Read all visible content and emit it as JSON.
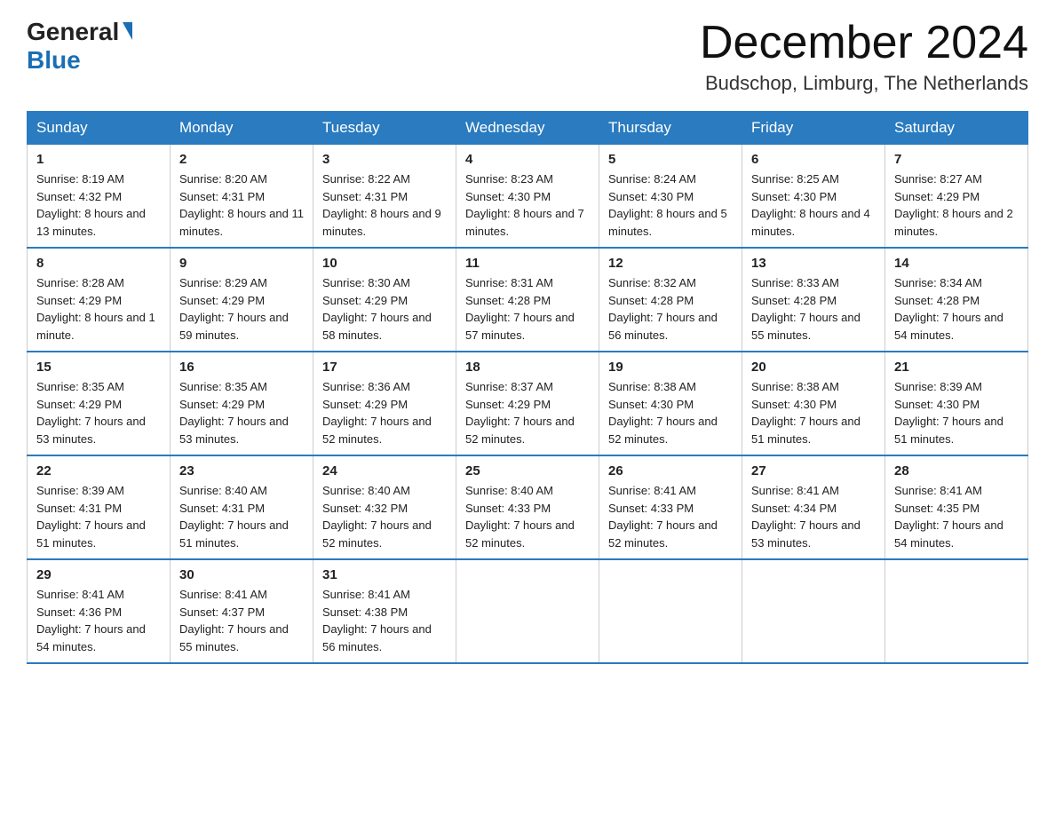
{
  "header": {
    "logo_general": "General",
    "logo_blue": "Blue",
    "month": "December 2024",
    "location": "Budschop, Limburg, The Netherlands"
  },
  "days_of_week": [
    "Sunday",
    "Monday",
    "Tuesday",
    "Wednesday",
    "Thursday",
    "Friday",
    "Saturday"
  ],
  "weeks": [
    [
      {
        "day": "1",
        "sunrise": "8:19 AM",
        "sunset": "4:32 PM",
        "daylight": "8 hours and 13 minutes."
      },
      {
        "day": "2",
        "sunrise": "8:20 AM",
        "sunset": "4:31 PM",
        "daylight": "8 hours and 11 minutes."
      },
      {
        "day": "3",
        "sunrise": "8:22 AM",
        "sunset": "4:31 PM",
        "daylight": "8 hours and 9 minutes."
      },
      {
        "day": "4",
        "sunrise": "8:23 AM",
        "sunset": "4:30 PM",
        "daylight": "8 hours and 7 minutes."
      },
      {
        "day": "5",
        "sunrise": "8:24 AM",
        "sunset": "4:30 PM",
        "daylight": "8 hours and 5 minutes."
      },
      {
        "day": "6",
        "sunrise": "8:25 AM",
        "sunset": "4:30 PM",
        "daylight": "8 hours and 4 minutes."
      },
      {
        "day": "7",
        "sunrise": "8:27 AM",
        "sunset": "4:29 PM",
        "daylight": "8 hours and 2 minutes."
      }
    ],
    [
      {
        "day": "8",
        "sunrise": "8:28 AM",
        "sunset": "4:29 PM",
        "daylight": "8 hours and 1 minute."
      },
      {
        "day": "9",
        "sunrise": "8:29 AM",
        "sunset": "4:29 PM",
        "daylight": "7 hours and 59 minutes."
      },
      {
        "day": "10",
        "sunrise": "8:30 AM",
        "sunset": "4:29 PM",
        "daylight": "7 hours and 58 minutes."
      },
      {
        "day": "11",
        "sunrise": "8:31 AM",
        "sunset": "4:28 PM",
        "daylight": "7 hours and 57 minutes."
      },
      {
        "day": "12",
        "sunrise": "8:32 AM",
        "sunset": "4:28 PM",
        "daylight": "7 hours and 56 minutes."
      },
      {
        "day": "13",
        "sunrise": "8:33 AM",
        "sunset": "4:28 PM",
        "daylight": "7 hours and 55 minutes."
      },
      {
        "day": "14",
        "sunrise": "8:34 AM",
        "sunset": "4:28 PM",
        "daylight": "7 hours and 54 minutes."
      }
    ],
    [
      {
        "day": "15",
        "sunrise": "8:35 AM",
        "sunset": "4:29 PM",
        "daylight": "7 hours and 53 minutes."
      },
      {
        "day": "16",
        "sunrise": "8:35 AM",
        "sunset": "4:29 PM",
        "daylight": "7 hours and 53 minutes."
      },
      {
        "day": "17",
        "sunrise": "8:36 AM",
        "sunset": "4:29 PM",
        "daylight": "7 hours and 52 minutes."
      },
      {
        "day": "18",
        "sunrise": "8:37 AM",
        "sunset": "4:29 PM",
        "daylight": "7 hours and 52 minutes."
      },
      {
        "day": "19",
        "sunrise": "8:38 AM",
        "sunset": "4:30 PM",
        "daylight": "7 hours and 52 minutes."
      },
      {
        "day": "20",
        "sunrise": "8:38 AM",
        "sunset": "4:30 PM",
        "daylight": "7 hours and 51 minutes."
      },
      {
        "day": "21",
        "sunrise": "8:39 AM",
        "sunset": "4:30 PM",
        "daylight": "7 hours and 51 minutes."
      }
    ],
    [
      {
        "day": "22",
        "sunrise": "8:39 AM",
        "sunset": "4:31 PM",
        "daylight": "7 hours and 51 minutes."
      },
      {
        "day": "23",
        "sunrise": "8:40 AM",
        "sunset": "4:31 PM",
        "daylight": "7 hours and 51 minutes."
      },
      {
        "day": "24",
        "sunrise": "8:40 AM",
        "sunset": "4:32 PM",
        "daylight": "7 hours and 52 minutes."
      },
      {
        "day": "25",
        "sunrise": "8:40 AM",
        "sunset": "4:33 PM",
        "daylight": "7 hours and 52 minutes."
      },
      {
        "day": "26",
        "sunrise": "8:41 AM",
        "sunset": "4:33 PM",
        "daylight": "7 hours and 52 minutes."
      },
      {
        "day": "27",
        "sunrise": "8:41 AM",
        "sunset": "4:34 PM",
        "daylight": "7 hours and 53 minutes."
      },
      {
        "day": "28",
        "sunrise": "8:41 AM",
        "sunset": "4:35 PM",
        "daylight": "7 hours and 54 minutes."
      }
    ],
    [
      {
        "day": "29",
        "sunrise": "8:41 AM",
        "sunset": "4:36 PM",
        "daylight": "7 hours and 54 minutes."
      },
      {
        "day": "30",
        "sunrise": "8:41 AM",
        "sunset": "4:37 PM",
        "daylight": "7 hours and 55 minutes."
      },
      {
        "day": "31",
        "sunrise": "8:41 AM",
        "sunset": "4:38 PM",
        "daylight": "7 hours and 56 minutes."
      },
      null,
      null,
      null,
      null
    ]
  ],
  "labels": {
    "sunrise": "Sunrise:",
    "sunset": "Sunset:",
    "daylight": "Daylight:"
  }
}
